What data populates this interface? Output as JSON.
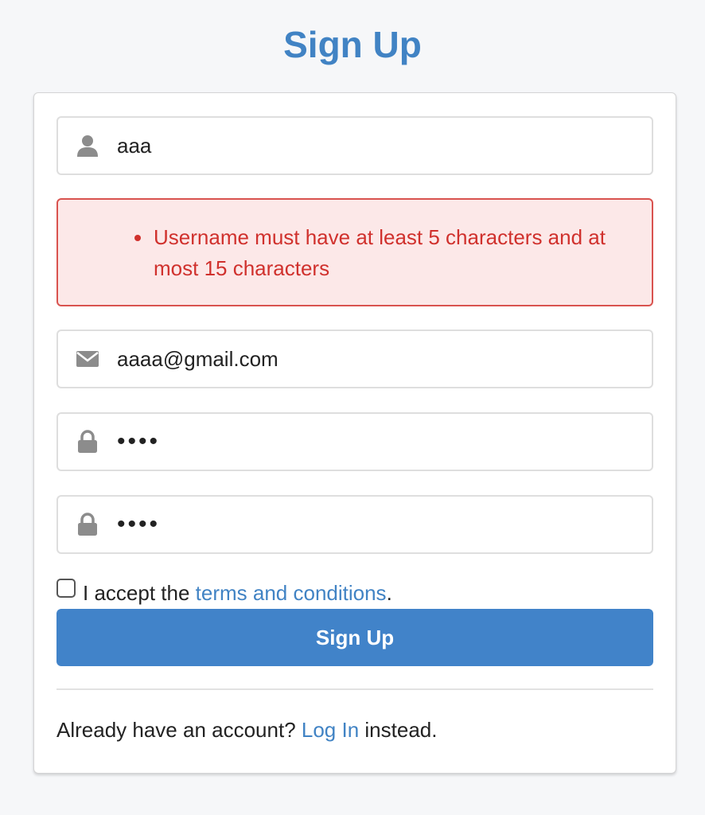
{
  "page": {
    "title": "Sign Up"
  },
  "form": {
    "username": {
      "value": "aaa",
      "icon": "user-icon"
    },
    "errors": [
      "Username must have at least 5 characters and at most 15 characters"
    ],
    "email": {
      "value": "aaaa@gmail.com",
      "icon": "envelope-icon"
    },
    "password": {
      "value": "aaaa",
      "icon": "lock-icon"
    },
    "confirm_password": {
      "value": "aaaa",
      "icon": "lock-icon"
    },
    "terms": {
      "checked": false,
      "prefix": "I accept the ",
      "link_label": "terms and conditions",
      "suffix": "."
    },
    "submit_label": "Sign Up"
  },
  "footer": {
    "prefix": "Already have an account? ",
    "link_label": "Log In",
    "suffix": " instead."
  },
  "colors": {
    "accent": "#4183c4",
    "error_text": "#d0312d",
    "error_bg": "#fce8e8",
    "background": "#f6f7f9"
  }
}
